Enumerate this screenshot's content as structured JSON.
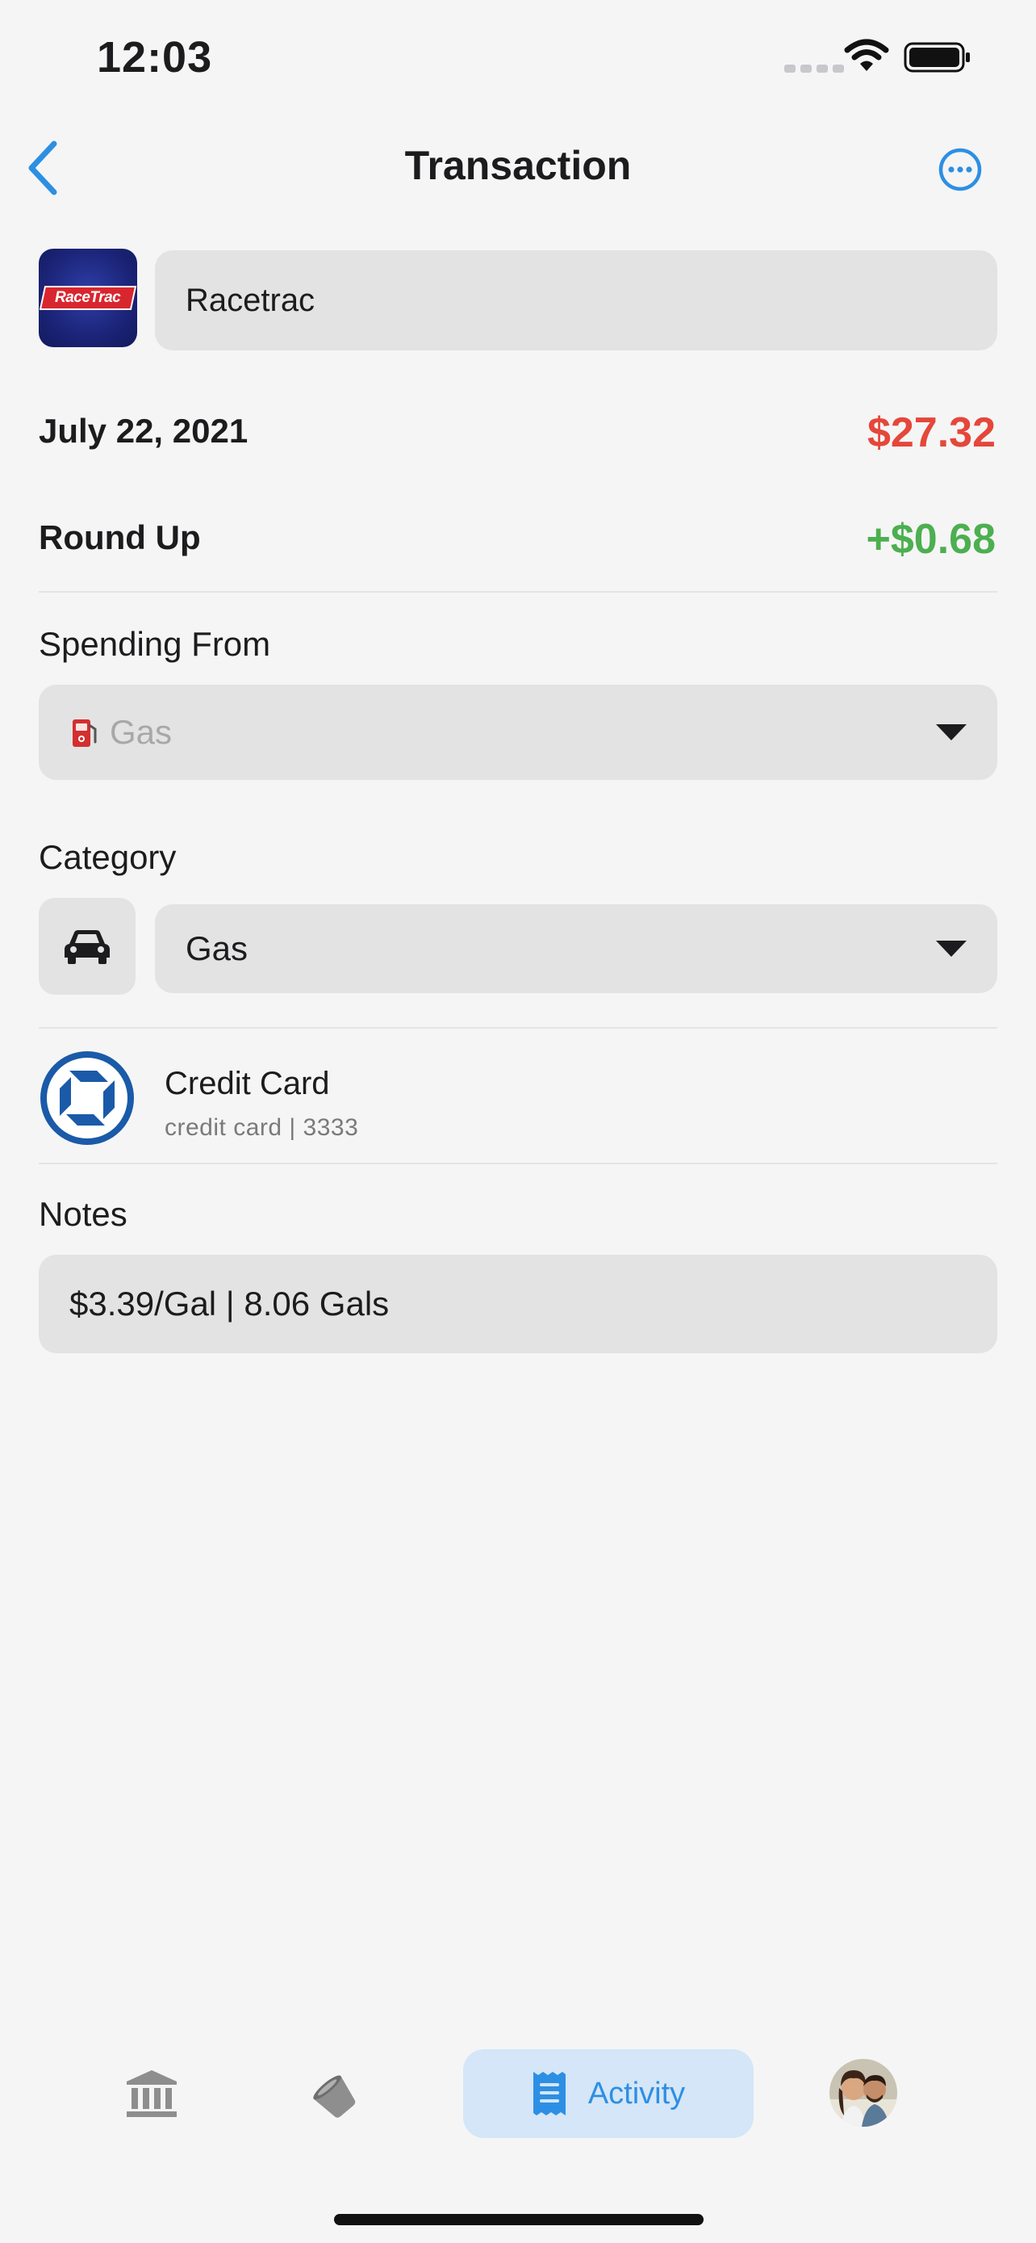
{
  "status_bar": {
    "time": "12:03"
  },
  "nav": {
    "title": "Transaction"
  },
  "merchant": {
    "logo_text": "RaceTrac",
    "name": "Racetrac"
  },
  "transaction": {
    "date": "July 22, 2021",
    "amount": "$27.32",
    "round_up_label": "Round Up",
    "round_up_amount": "+$0.68"
  },
  "spending_from": {
    "label": "Spending From",
    "value": "Gas",
    "icon": "fuel-pump-icon"
  },
  "category": {
    "label": "Category",
    "value": "Gas",
    "icon": "car-icon"
  },
  "account": {
    "name": "Credit Card",
    "detail": "credit card | 3333"
  },
  "notes": {
    "label": "Notes",
    "value": "$3.39/Gal | 8.06 Gals"
  },
  "tab_bar": {
    "items": [
      {
        "icon": "bank-icon"
      },
      {
        "icon": "budget-bucket-icon"
      },
      {
        "icon": "receipt-icon",
        "label": "Activity",
        "selected": true
      },
      {
        "icon": "profile-avatar"
      }
    ]
  },
  "colors": {
    "accent": "#2d8fe3",
    "expense": "#e5473a",
    "positive": "#4caf50",
    "field_bg": "#e3e3e3",
    "background": "#f5f5f5"
  }
}
